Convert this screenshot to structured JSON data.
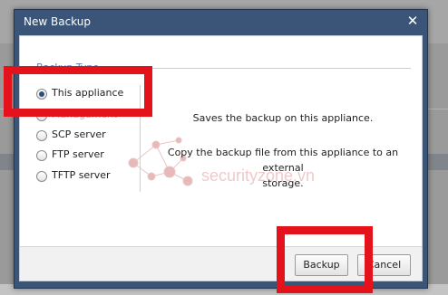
{
  "dialog": {
    "title": "New Backup",
    "close_icon": "close-icon",
    "section_title": "Backup Type",
    "options": [
      {
        "label": "This appliance",
        "checked": true
      },
      {
        "label": "Management",
        "checked": false
      },
      {
        "label": "SCP server",
        "checked": false
      },
      {
        "label": "FTP server",
        "checked": false
      },
      {
        "label": "TFTP server",
        "checked": false
      }
    ],
    "description_1": "Saves the backup on this appliance.",
    "description_2_line1": "Copy the backup file from this appliance to an external",
    "description_2_line2": "storage.",
    "watermark_text": "securityzone.vn",
    "backup_label": "Backup",
    "cancel_label": "Cancel"
  },
  "colors": {
    "titlebar": "#3a5577",
    "annotation_red": "#e3121b",
    "section_title": "#5a7fb0"
  }
}
